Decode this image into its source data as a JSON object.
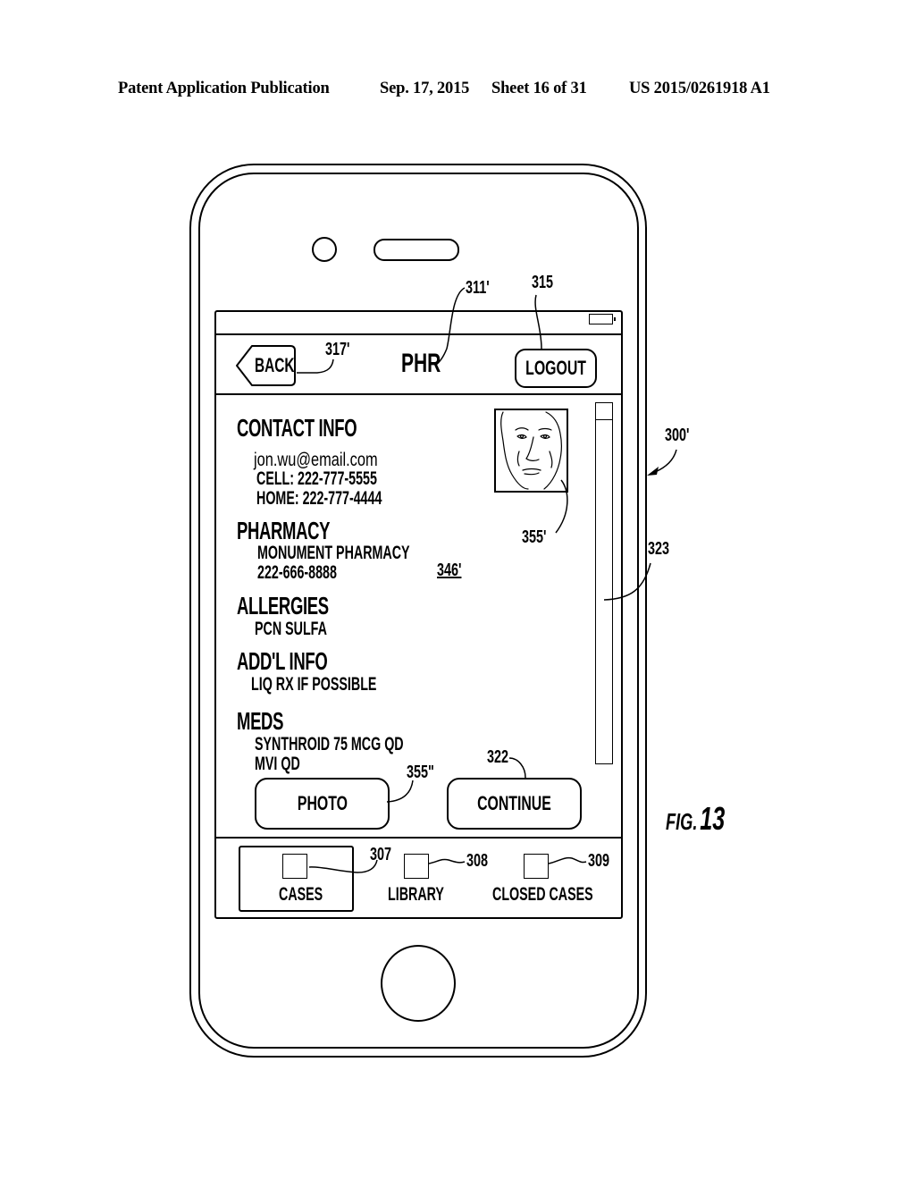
{
  "patent_header": {
    "publication_type": "Patent Application Publication",
    "date": "Sep. 17, 2015",
    "sheet": "Sheet 16 of 31",
    "number": "US 2015/0261918 A1"
  },
  "figure_label": {
    "prefix": "FIG.",
    "number": "13"
  },
  "reference_numerals": {
    "device": "300'",
    "title": "311'",
    "logout": "315",
    "back": "317'",
    "photo_image": "355'",
    "content_area": "346'",
    "scrollbar": "323",
    "continue": "322",
    "photo_button": "355\"",
    "tab_cases": "307",
    "tab_library": "308",
    "tab_closed_cases": "309"
  },
  "app": {
    "status_bar": {
      "battery_icon": "battery-icon"
    },
    "header": {
      "back_label": "BACK",
      "title": "PHR",
      "logout_label": "LOGOUT"
    },
    "sections": [
      {
        "title": "CONTACT INFO",
        "lines": [
          "jon.wu@email.com",
          "CELL: 222-777-5555",
          "HOME: 222-777-4444"
        ]
      },
      {
        "title": "PHARMACY",
        "lines": [
          "MONUMENT PHARMACY",
          "222-666-8888"
        ]
      },
      {
        "title": "ALLERGIES",
        "lines": [
          "PCN SULFA"
        ]
      },
      {
        "title": "ADD'L INFO",
        "lines": [
          "LIQ RX IF POSSIBLE"
        ]
      },
      {
        "title": "MEDS",
        "lines": [
          "SYNTHROID 75 MCG QD",
          "MVI QD"
        ]
      }
    ],
    "actions": {
      "photo_label": "PHOTO",
      "continue_label": "CONTINUE"
    },
    "tabs": [
      {
        "label": "CASES",
        "icon": "square-icon",
        "selected": true
      },
      {
        "label": "LIBRARY",
        "icon": "square-icon",
        "selected": false
      },
      {
        "label": "CLOSED CASES",
        "icon": "square-icon",
        "selected": false
      }
    ]
  }
}
